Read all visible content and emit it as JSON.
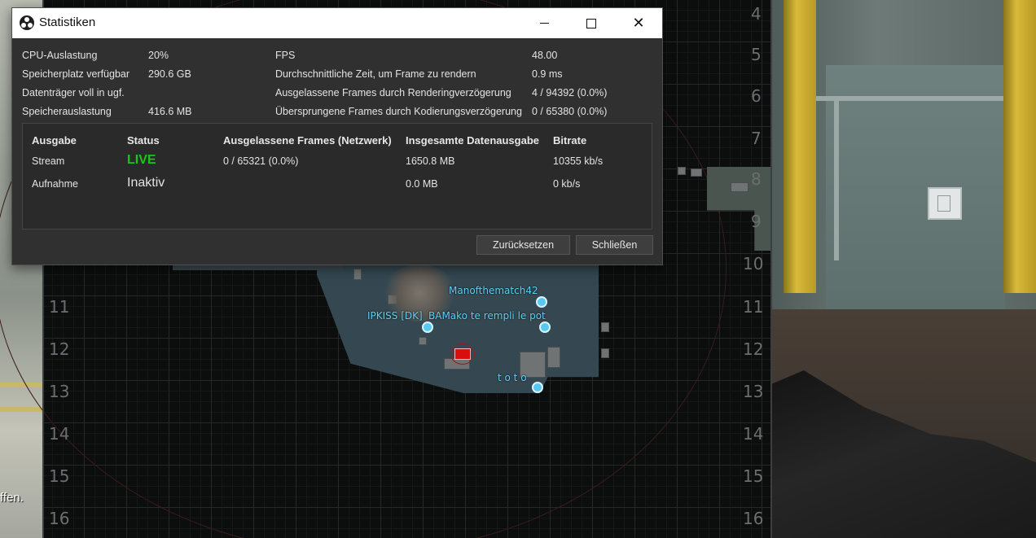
{
  "window": {
    "title": "Statistiken",
    "controls": {
      "minimize": "minimize",
      "maximize": "maximize",
      "close": "close"
    }
  },
  "stats_left": [
    {
      "label": "CPU-Auslastung",
      "value": "20%"
    },
    {
      "label": "Speicherplatz verfügbar",
      "value": "290.6 GB"
    },
    {
      "label": "Datenträger voll in ugf.",
      "value": ""
    },
    {
      "label": "Speicherauslastung",
      "value": "416.6 MB"
    }
  ],
  "stats_right": [
    {
      "label": "FPS",
      "value": "48.00"
    },
    {
      "label": "Durchschnittliche Zeit, um Frame zu rendern",
      "value": "0.9 ms"
    },
    {
      "label": "Ausgelassene Frames durch Renderingverzögerung",
      "value": "4 / 94392 (0.0%)"
    },
    {
      "label": "Übersprungene Frames durch Kodierungsverzögerung",
      "value": "0 / 65380 (0.0%)"
    }
  ],
  "outputs": {
    "headers": [
      "Ausgabe",
      "Status",
      "Ausgelassene Frames (Netzwerk)",
      "Insgesamte Datenausgabe",
      "Bitrate"
    ],
    "rows": [
      {
        "name": "Stream",
        "status": "LIVE",
        "dropped": "0 / 65321 (0.0%)",
        "total": "1650.8 MB",
        "bitrate": "10355 kb/s"
      },
      {
        "name": "Aufnahme",
        "status": "Inaktiv",
        "dropped": "",
        "total": "0.0 MB",
        "bitrate": "0 kb/s"
      }
    ]
  },
  "buttons": {
    "reset": "Zurücksetzen",
    "close": "Schließen"
  },
  "background": {
    "left_text": "ffen.",
    "radar_rows": [
      "4",
      "5",
      "6",
      "7",
      "8",
      "9",
      "10",
      "11",
      "12",
      "13",
      "14",
      "15",
      "16"
    ],
    "players": [
      {
        "name": "Manofthematch42"
      },
      {
        "name": "IPKISS [DK]"
      },
      {
        "name": "BAMako te rempli le pot"
      },
      {
        "name": "t o t o"
      }
    ]
  },
  "colors": {
    "window_bg": "#303030",
    "live_green": "#1bc41b",
    "player_blue": "#57c8f2",
    "bomb_red": "#d90f0f"
  }
}
